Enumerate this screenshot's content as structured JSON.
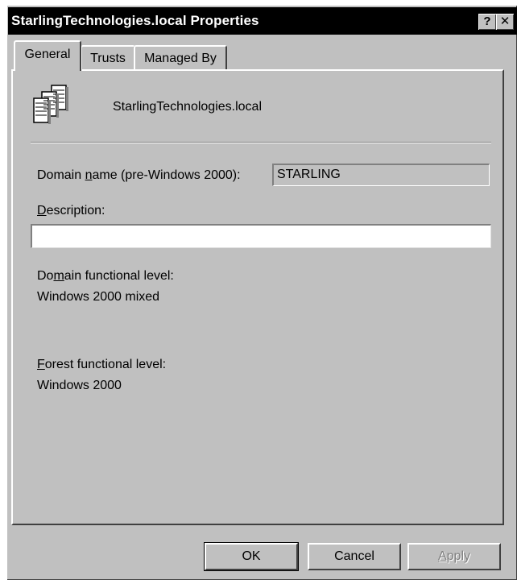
{
  "window": {
    "title": "StarlingTechnologies.local Properties",
    "help_label": "?",
    "close_label": "✕"
  },
  "tabs": [
    {
      "label": "General",
      "active": true
    },
    {
      "label": "Trusts",
      "active": false
    },
    {
      "label": "Managed By",
      "active": false
    }
  ],
  "general": {
    "domain_title": "StarlingTechnologies.local",
    "icon": "domain-icon",
    "pre2000": {
      "label_before": "Domain ",
      "label_underlined": "n",
      "label_after": "ame (pre-Windows 2000):",
      "value": "STARLING"
    },
    "description": {
      "label_underlined": "D",
      "label_after": "escription:",
      "value": ""
    },
    "domain_level": {
      "label_before": "Do",
      "label_underlined": "m",
      "label_after": "ain functional level:",
      "value": "Windows 2000 mixed"
    },
    "forest_level": {
      "label_underlined": "F",
      "label_after": "orest functional level:",
      "value": "Windows 2000"
    }
  },
  "buttons": {
    "ok": "OK",
    "cancel": "Cancel",
    "apply_underlined": "A",
    "apply_after": "pply"
  }
}
